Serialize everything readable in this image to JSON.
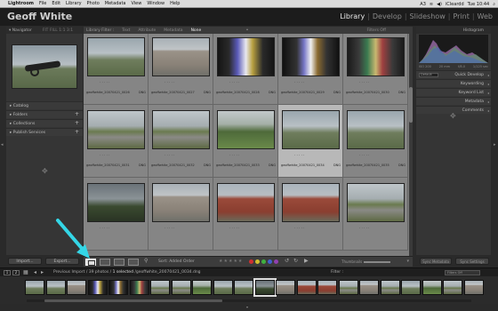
{
  "menubar": {
    "app": "Lightroom",
    "items": [
      "File",
      "Edit",
      "Library",
      "Photo",
      "Metadata",
      "View",
      "Window",
      "Help"
    ],
    "right": [
      "A3",
      "iCleardd",
      "Tue 10:44"
    ]
  },
  "identity_plate": "Geoff White",
  "modules": [
    {
      "label": "Library",
      "active": true
    },
    {
      "label": "Develop",
      "active": false
    },
    {
      "label": "Slideshow",
      "active": false
    },
    {
      "label": "Print",
      "active": false
    },
    {
      "label": "Web",
      "active": false
    }
  ],
  "left_panel": {
    "navigator": "Navigator",
    "nav_zoom": "FIT  FILL  1:1  3:1",
    "groups": [
      "Catalog",
      "Folders",
      "Collections",
      "Publish Services"
    ]
  },
  "filter_bar": {
    "title": "Library Filter :",
    "options": [
      {
        "label": "Text",
        "on": false
      },
      {
        "label": "Attribute",
        "on": false
      },
      {
        "label": "Metadata",
        "on": false
      },
      {
        "label": "None",
        "on": true
      }
    ],
    "right": "Filters Off"
  },
  "grid": {
    "cells": [
      {
        "caption": "geoffwhite_20070421_0026",
        "ext": "DNG",
        "style": "p-cannon",
        "selected": false
      },
      {
        "caption": "geoffwhite_20070421_0027",
        "ext": "DNG",
        "style": "p-house",
        "selected": false
      },
      {
        "caption": "geoffwhite_20070421_0028",
        "ext": "DNG",
        "style": "p-stain",
        "selected": false
      },
      {
        "caption": "geoffwhite_20070421_0029",
        "ext": "DNG",
        "style": "p-stain2",
        "selected": false
      },
      {
        "caption": "geoffwhite_20070421_0030",
        "ext": "DNG",
        "style": "p-stain3",
        "selected": false
      },
      {
        "caption": "geoffwhite_20070421_0031",
        "ext": "DNG",
        "style": "p-road",
        "selected": false
      },
      {
        "caption": "geoffwhite_20070421_0032",
        "ext": "DNG",
        "style": "p-road",
        "selected": false
      },
      {
        "caption": "geoffwhite_20070421_0033",
        "ext": "DNG",
        "style": "p-tank",
        "selected": false
      },
      {
        "caption": "geoffwhite_20070421_0034",
        "ext": "DNG",
        "style": "p-cannon",
        "selected": true
      },
      {
        "caption": "geoffwhite_20070421_0035",
        "ext": "DNG",
        "style": "p-cannon",
        "selected": false
      },
      {
        "caption": "",
        "ext": "",
        "style": "p-dark",
        "selected": false
      },
      {
        "caption": "",
        "ext": "",
        "style": "p-house",
        "selected": false
      },
      {
        "caption": "",
        "ext": "",
        "style": "p-brick",
        "selected": false
      },
      {
        "caption": "",
        "ext": "",
        "style": "p-brick",
        "selected": false
      },
      {
        "caption": "",
        "ext": "",
        "style": "p-road",
        "selected": false
      }
    ]
  },
  "right_panel": {
    "histogram": "Histogram",
    "hist_info": [
      "ISO 200",
      "20 mm",
      "f/8.0",
      "1/125 sec"
    ],
    "groups": [
      "Quick Develop",
      "Keywording",
      "Keyword List",
      "Metadata",
      "Comments"
    ],
    "preset": "Default"
  },
  "bottom_left": {
    "import": "Import...",
    "export": "Export..."
  },
  "toolbar": {
    "sort_label": "Sort:",
    "sort_value": "Added Order",
    "stars": "★★★★★",
    "colors": [
      "#d03030",
      "#d0c030",
      "#40b040",
      "#4060d0",
      "#9040b0"
    ],
    "thumbnails": "Thumbnails"
  },
  "bottom_right": {
    "sync": "Sync Settings",
    "sync_meta": "Sync Metadata"
  },
  "filmstrip_bar": {
    "nums": [
      "1",
      "2"
    ],
    "source": "Previous Import",
    "count": "/ 39 photos /",
    "selected": "1 selected",
    "file": "/geoffwhite_20070421_0034.dng",
    "filter": "Filter :",
    "filter_value": "Filters Off"
  },
  "filmstrip": [
    "p-cannon",
    "p-cannon",
    "p-house",
    "p-stain",
    "p-stain2",
    "p-stain3",
    "p-road",
    "p-road",
    "p-tank",
    "p-cannon",
    "p-cannon",
    "p-dark",
    "p-house",
    "p-brick",
    "p-brick",
    "p-road",
    "p-house",
    "p-road",
    "p-cannon",
    "p-tank",
    "p-road",
    "p-house"
  ],
  "annotation_arrow_color": "#34d6e6"
}
